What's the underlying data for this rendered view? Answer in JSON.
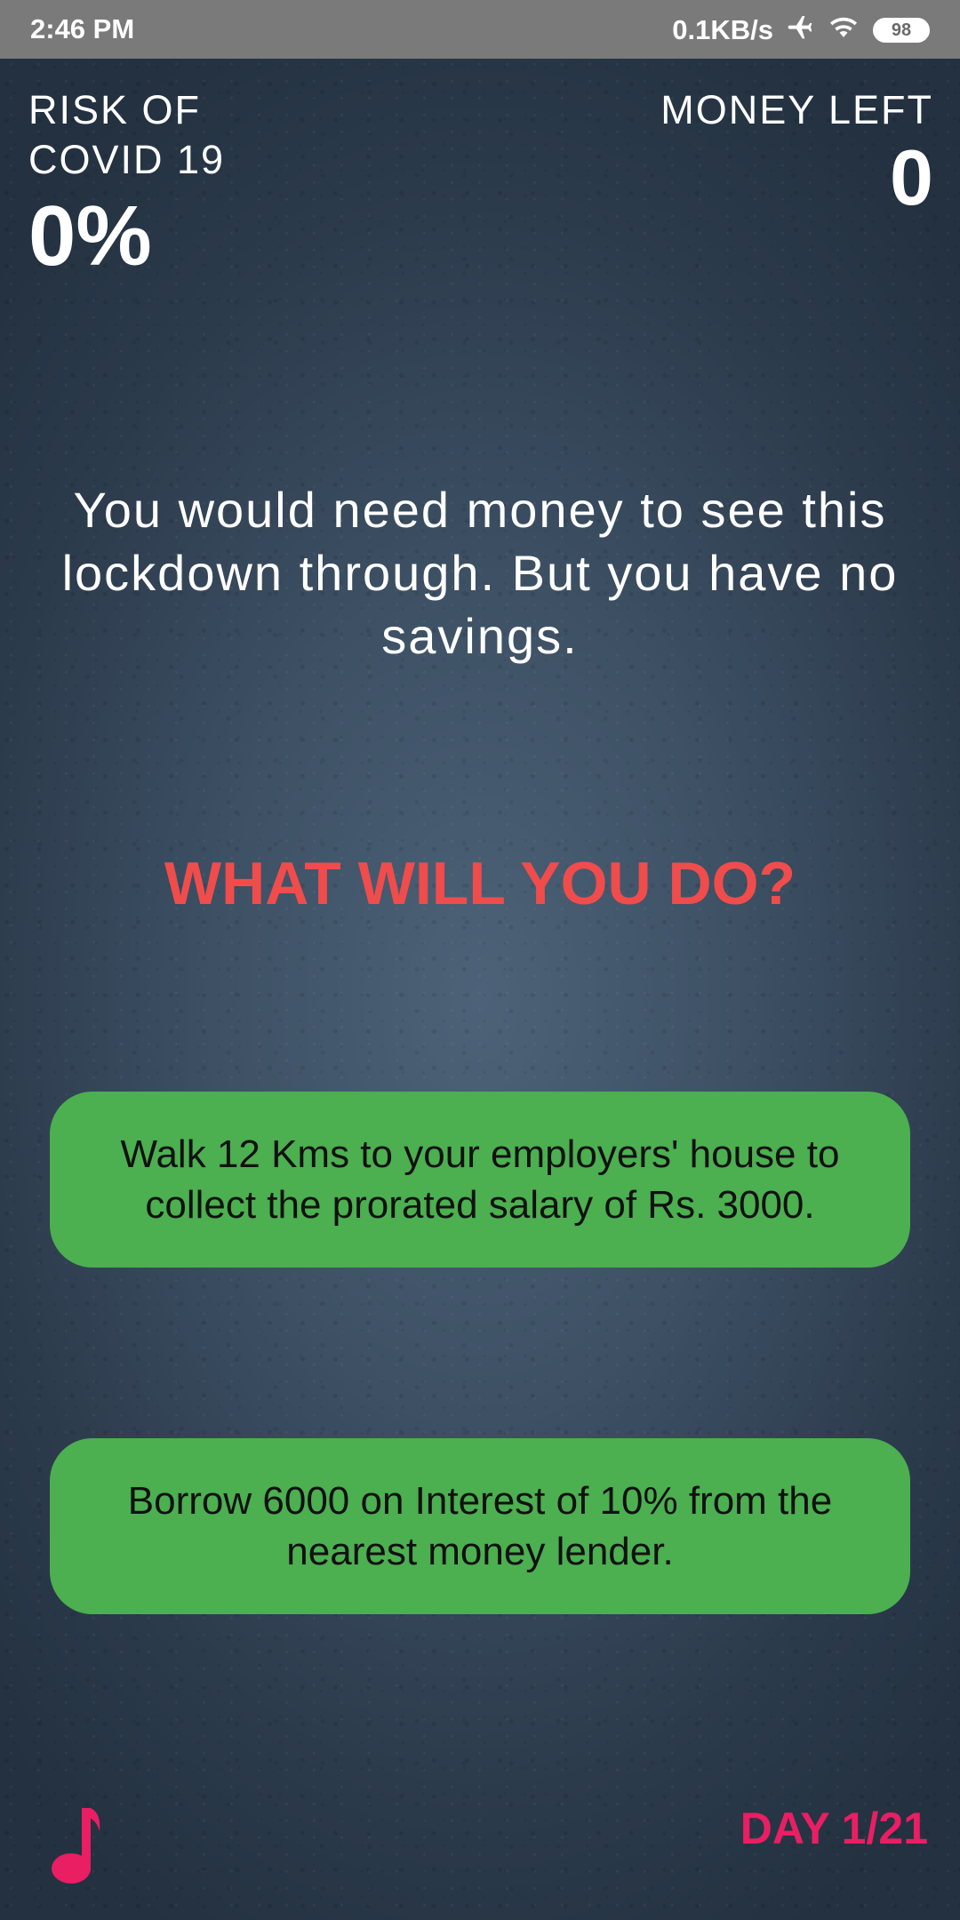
{
  "status_bar": {
    "time": "2:46 PM",
    "network_speed": "0.1KB/s",
    "battery": "98"
  },
  "hud": {
    "risk_label": "RISK OF COVID 19",
    "risk_value": "0%",
    "money_label": "MONEY LEFT",
    "money_value": "0"
  },
  "story": {
    "text": "You would need money to see this lockdown through. But you have no savings."
  },
  "prompt": {
    "heading": "WHAT WILL YOU DO?"
  },
  "choices": [
    {
      "label": "Walk 12 Kms to your employers' house to collect the prorated salary of Rs. 3000."
    },
    {
      "label": "Borrow 6000 on Interest of 10% from the nearest money lender."
    }
  ],
  "footer": {
    "day_counter": "DAY 1/21",
    "music_icon": "music-note-icon"
  },
  "colors": {
    "choice_bg": "#4caf50",
    "heading": "#f04c4c",
    "accent": "#e91e63",
    "status_bar": "#7a7a7a"
  }
}
